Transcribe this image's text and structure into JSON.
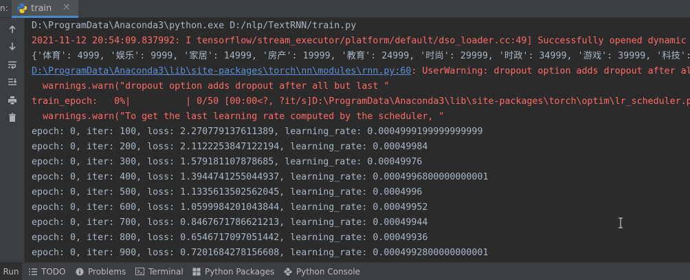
{
  "tabbar": {
    "prefix": "n:",
    "tab_label": "train",
    "close_symbol": "✕"
  },
  "toolbar": {
    "icons": [
      "arrow-up-icon",
      "arrow-down-icon",
      "soft-wrap-icon",
      "scroll-to-end-icon",
      "print-icon",
      "trash-icon"
    ]
  },
  "console": {
    "lines": [
      {
        "style": "normal",
        "text": "D:\\ProgramData\\Anaconda3\\python.exe D:/nlp/TextRNN/train.py"
      },
      {
        "style": "err",
        "text": "2021-11-12 20:54:09.837992: I tensorflow/stream_executor/platform/default/dso_loader.cc:49] Successfully opened dynamic"
      },
      {
        "style": "normal",
        "text": "{'体育': 4999, '娱乐': 9999, '家居': 14999, '房产': 19999, '教育': 24999, '时尚': 29999, '时政': 34999, '游戏': 39999, '科技':"
      },
      {
        "style": "err",
        "link": "D:\\ProgramData\\Anaconda3\\lib\\site-packages\\torch\\nn\\modules\\rnn.py:60",
        "text": ": UserWarning: dropout option adds dropout after al"
      },
      {
        "style": "err",
        "text": "  warnings.warn(\"dropout option adds dropout after all but last \""
      },
      {
        "style": "err",
        "text": "train_epoch:   0%|          | 0/50 [00:00<?, ?it/s]D:\\ProgramData\\Anaconda3\\lib\\site-packages\\torch\\optim\\lr_scheduler.p"
      },
      {
        "style": "err",
        "text": "  warnings.warn(\"To get the last learning rate computed by the scheduler, \""
      },
      {
        "style": "normal",
        "text": "epoch: 0, iter: 100, loss: 2.270779137611389, learning_rate: 0.0004999199999999999"
      },
      {
        "style": "normal",
        "text": "epoch: 0, iter: 200, loss: 2.1122253847122194, learning_rate: 0.00049984"
      },
      {
        "style": "normal",
        "text": "epoch: 0, iter: 300, loss: 1.579181107878685, learning_rate: 0.00049976"
      },
      {
        "style": "normal",
        "text": "epoch: 0, iter: 400, loss: 1.3944741255044937, learning_rate: 0.0004996800000000001"
      },
      {
        "style": "normal",
        "text": "epoch: 0, iter: 500, loss: 1.1335613502562045, learning_rate: 0.0004996"
      },
      {
        "style": "normal",
        "text": "epoch: 0, iter: 600, loss: 1.0599984201043844, learning_rate: 0.00049952"
      },
      {
        "style": "normal",
        "text": "epoch: 0, iter: 700, loss: 0.8467671786621213, learning_rate: 0.00049944"
      },
      {
        "style": "normal",
        "text": "epoch: 0, iter: 800, loss: 0.6546717097051442, learning_rate: 0.00049936"
      },
      {
        "style": "normal",
        "text": "epoch: 0, iter: 900, loss: 0.7201684278156608, learning_rate: 0.0004992800000000001"
      }
    ]
  },
  "bottombar": {
    "run": "Run",
    "todo": "TODO",
    "problems": "Problems",
    "terminal": "Terminal",
    "python_packages": "Python Packages",
    "python_console": "Python Console"
  },
  "colors": {
    "background": "#2b2b2b",
    "toolbar": "#3c3f41",
    "normal_text": "#a9b7c6",
    "error_text": "#ff6b68",
    "link": "#5c8ed8",
    "accent": "#4a88c7"
  }
}
